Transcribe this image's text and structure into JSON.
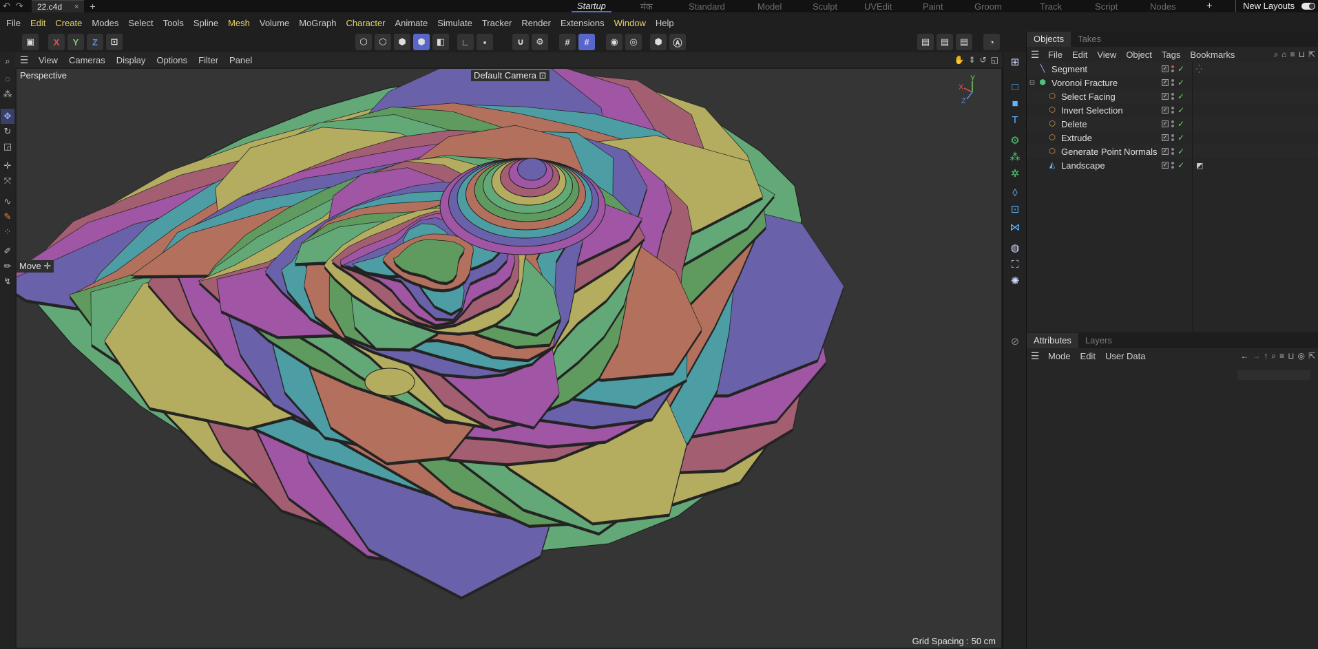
{
  "tabbar": {
    "document": "22.c4d",
    "close": "×",
    "new_tab": "+",
    "layouts": [
      "Startup",
      "मंक",
      "Standard",
      "Model",
      "Sculpt",
      "UVEdit",
      "Paint",
      "Groom",
      "Track",
      "Script",
      "Nodes"
    ],
    "add_layout": "+",
    "new_layouts": "New Layouts"
  },
  "menu": {
    "items": [
      {
        "label": "File"
      },
      {
        "label": "Edit",
        "hl": true
      },
      {
        "label": "Create",
        "hl": true
      },
      {
        "label": "Modes"
      },
      {
        "label": "Select"
      },
      {
        "label": "Tools"
      },
      {
        "label": "Spline"
      },
      {
        "label": "Mesh",
        "hl": true
      },
      {
        "label": "Volume"
      },
      {
        "label": "MoGraph"
      },
      {
        "label": "Character",
        "hl": true
      },
      {
        "label": "Animate"
      },
      {
        "label": "Simulate"
      },
      {
        "label": "Tracker"
      },
      {
        "label": "Render"
      },
      {
        "label": "Extensions"
      },
      {
        "label": "Window",
        "hl": true
      },
      {
        "label": "Help"
      }
    ]
  },
  "toolbar": {
    "x": "X",
    "y": "Y",
    "z": "Z"
  },
  "viewport": {
    "menu": [
      "View",
      "Cameras",
      "Display",
      "Options",
      "Filter",
      "Panel"
    ],
    "label": "Perspective",
    "camera": "Default Camera",
    "move_hud": "Move",
    "grid_spacing": "Grid Spacing : 50 cm",
    "axis": {
      "x": "X",
      "y": "Y",
      "z": "Z"
    }
  },
  "objects": {
    "tabs": [
      "Objects",
      "Takes"
    ],
    "menu": [
      "File",
      "Edit",
      "View",
      "Object",
      "Tags",
      "Bookmarks"
    ],
    "items": [
      {
        "name": "Segment",
        "icon": "spline-icon",
        "indent": 0
      },
      {
        "name": "Voronoi Fracture",
        "icon": "fracture-icon",
        "indent": 0
      },
      {
        "name": "Select Facing",
        "icon": "deformer-icon",
        "indent": 1
      },
      {
        "name": "Invert Selection",
        "icon": "deformer-icon",
        "indent": 1
      },
      {
        "name": "Delete",
        "icon": "deformer-icon",
        "indent": 1
      },
      {
        "name": "Extrude",
        "icon": "deformer-icon",
        "indent": 1
      },
      {
        "name": "Generate Point Normals",
        "icon": "deformer-icon",
        "indent": 1
      },
      {
        "name": "Landscape",
        "icon": "landscape-icon",
        "indent": 1
      }
    ]
  },
  "attributes": {
    "tabs": [
      "Attributes",
      "Layers"
    ],
    "menu": [
      "Mode",
      "Edit",
      "User Data"
    ]
  },
  "colors": {
    "accent": "#5866c9",
    "highlight_menu": "#e8d36a",
    "terrain": [
      "#63a978",
      "#b4ad5f",
      "#a45e72",
      "#a055a5",
      "#6a61ab",
      "#4d9ea4",
      "#b3715d",
      "#5f9b5e"
    ]
  }
}
